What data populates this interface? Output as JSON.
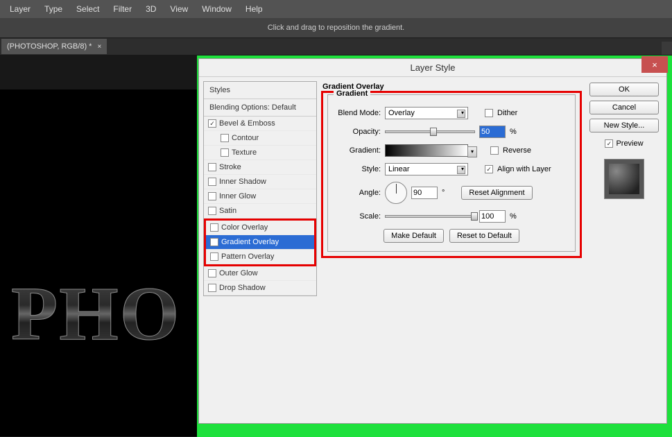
{
  "menu": [
    "Layer",
    "Type",
    "Select",
    "Filter",
    "3D",
    "View",
    "Window",
    "Help"
  ],
  "hint": "Click and drag to reposition the gradient.",
  "tab": {
    "label": "(PHOTOSHOP, RGB/8) *",
    "close": "×"
  },
  "canvas_text": "PHO",
  "dialog": {
    "title": "Layer Style",
    "close": "×",
    "styles_header": "Styles",
    "blend_header": "Blending Options: Default",
    "items": [
      {
        "label": "Bevel & Emboss",
        "checked": true
      },
      {
        "label": "Contour",
        "checked": false,
        "sub": true
      },
      {
        "label": "Texture",
        "checked": false,
        "sub": true
      },
      {
        "label": "Stroke",
        "checked": false
      },
      {
        "label": "Inner Shadow",
        "checked": false
      },
      {
        "label": "Inner Glow",
        "checked": false
      },
      {
        "label": "Satin",
        "checked": false
      },
      {
        "label": "Color Overlay",
        "checked": false,
        "redtop": true
      },
      {
        "label": "Gradient Overlay",
        "checked": true,
        "selected": true,
        "red": true
      },
      {
        "label": "Pattern Overlay",
        "checked": false,
        "redbot": true
      },
      {
        "label": "Outer Glow",
        "checked": false
      },
      {
        "label": "Drop Shadow",
        "checked": false
      }
    ],
    "section_title": "Gradient Overlay",
    "group_title": "Gradient",
    "blend_mode_lbl": "Blend Mode:",
    "blend_mode_val": "Overlay",
    "dither_lbl": "Dither",
    "opacity_lbl": "Opacity:",
    "opacity_val": "50",
    "gradient_lbl": "Gradient:",
    "reverse_lbl": "Reverse",
    "style_lbl": "Style:",
    "style_val": "Linear",
    "align_lbl": "Align with Layer",
    "angle_lbl": "Angle:",
    "angle_val": "90",
    "deg": "°",
    "reset_align": "Reset Alignment",
    "scale_lbl": "Scale:",
    "scale_val": "100",
    "make_default": "Make Default",
    "reset_default": "Reset to Default",
    "ok": "OK",
    "cancel": "Cancel",
    "new_style": "New Style...",
    "preview_lbl": "Preview",
    "pct": "%"
  }
}
